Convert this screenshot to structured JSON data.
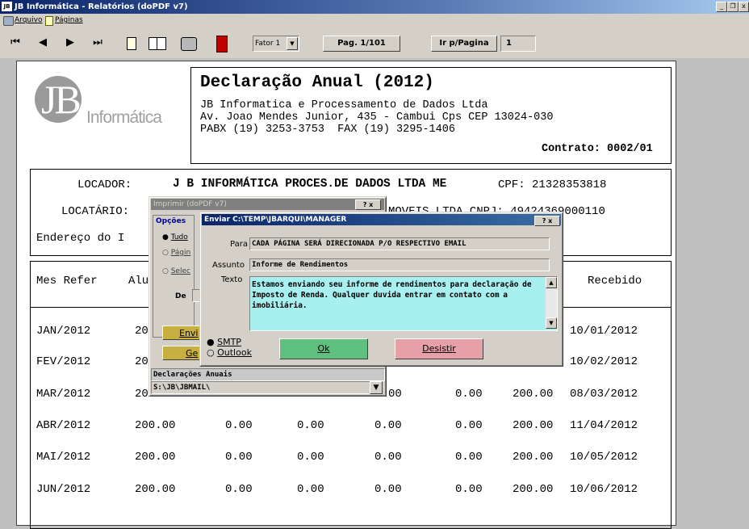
{
  "window": {
    "app_icon": "JB",
    "title": "JB Informática - Relatórios (doPDF v7)",
    "controls": {
      "minimize": "_",
      "restore": "❐",
      "close": "x"
    }
  },
  "menu": [
    {
      "label": "Arquivo",
      "icon": "printer-icon"
    },
    {
      "label": "Páginas",
      "icon": "page-icon"
    }
  ],
  "toolbar": {
    "factor_label": "Fator 1",
    "page_label": "Pag. 1/101",
    "goto_label": "Ir p/Pagina",
    "goto_value": "1"
  },
  "report": {
    "logo_text": "Informática",
    "logo_mark": "JB",
    "title": "Declaração Anual (2012)",
    "company": [
      "JB Informatica e Processamento de Dados Ltda",
      "Av. Joao Mendes Junior, 435 - Cambui Cps CEP 13024-030",
      "PABX (19) 3253-3753  FAX (19) 3295-1406"
    ],
    "contract": "Contrato: 0002/01",
    "locador_label": "LOCADOR:",
    "locador_value": "J B INFORMÁTICA PROCES.DE DADOS LTDA ME",
    "cpf": "CPF: 21328353818",
    "locatario_label": "LOCATÁRIO:",
    "locatario_tail": "MOVEIS LTDA CNPJ: 49424369000110",
    "endereco_label": "Endereço do I",
    "col_mes": "Mes Refer",
    "col_alu": "Alu",
    "col_recebido": "Recebido",
    "rows": [
      [
        "JAN/2012",
        "20",
        "",
        "",
        "",
        "",
        "",
        "10/01/2012"
      ],
      [
        "FEV/2012",
        "20",
        "",
        "",
        "",
        "",
        "",
        "10/02/2012"
      ],
      [
        "MAR/2012",
        "20",
        "",
        "",
        "00",
        "0.00",
        "200.00",
        "08/03/2012"
      ],
      [
        "ABR/2012",
        "200.00",
        "0.00",
        "0.00",
        "0.00",
        "0.00",
        "200.00",
        "11/04/2012"
      ],
      [
        "MAI/2012",
        "200.00",
        "0.00",
        "0.00",
        "0.00",
        "0.00",
        "200.00",
        "10/05/2012"
      ],
      [
        "JUN/2012",
        "200.00",
        "0.00",
        "0.00",
        "0.00",
        "0.00",
        "200.00",
        "10/06/2012"
      ]
    ]
  },
  "print_dialog": {
    "title": "Imprimir (doPDF v7)",
    "help_close": "? x",
    "group_label": "Opções",
    "opt_all": "Tudo",
    "opt_pages": "Págin",
    "opt_selection": "Selec",
    "de_label": "De",
    "send_btn": "Envi",
    "gen_btn": "Ge",
    "declaracoes_label": "Declarações Anuais",
    "path_value": "S:\\JB\\JBMAIL\\"
  },
  "send_dialog": {
    "title": "Enviar C:\\TEMP\\JBARQUI\\MANAGER",
    "help_close": "? x",
    "para_label": "Para",
    "para_value": "CADA PÁGINA SERÁ DIRECIONADA P/O RESPECTIVO EMAIL",
    "assunto_label": "Assunto",
    "assunto_value": "Informe de Rendimentos",
    "texto_label": "Texto",
    "texto_value": "Estamos enviando seu informe de rendimentos para declaração de Imposto de Renda. Qualquer duvida entrar em contato com a imobiliária.",
    "smtp_label": "SMTP",
    "outlook_label": "Outlook",
    "ok_label": "Ok",
    "desistir_label": "Desistir"
  },
  "colors": {
    "title_gradient_start": "#0a246a",
    "title_gradient_end": "#a6caf0",
    "textarea_bg": "#a8f0f0",
    "ok_btn": "#5fbf7f",
    "desistir_btn": "#e8a0a8"
  }
}
